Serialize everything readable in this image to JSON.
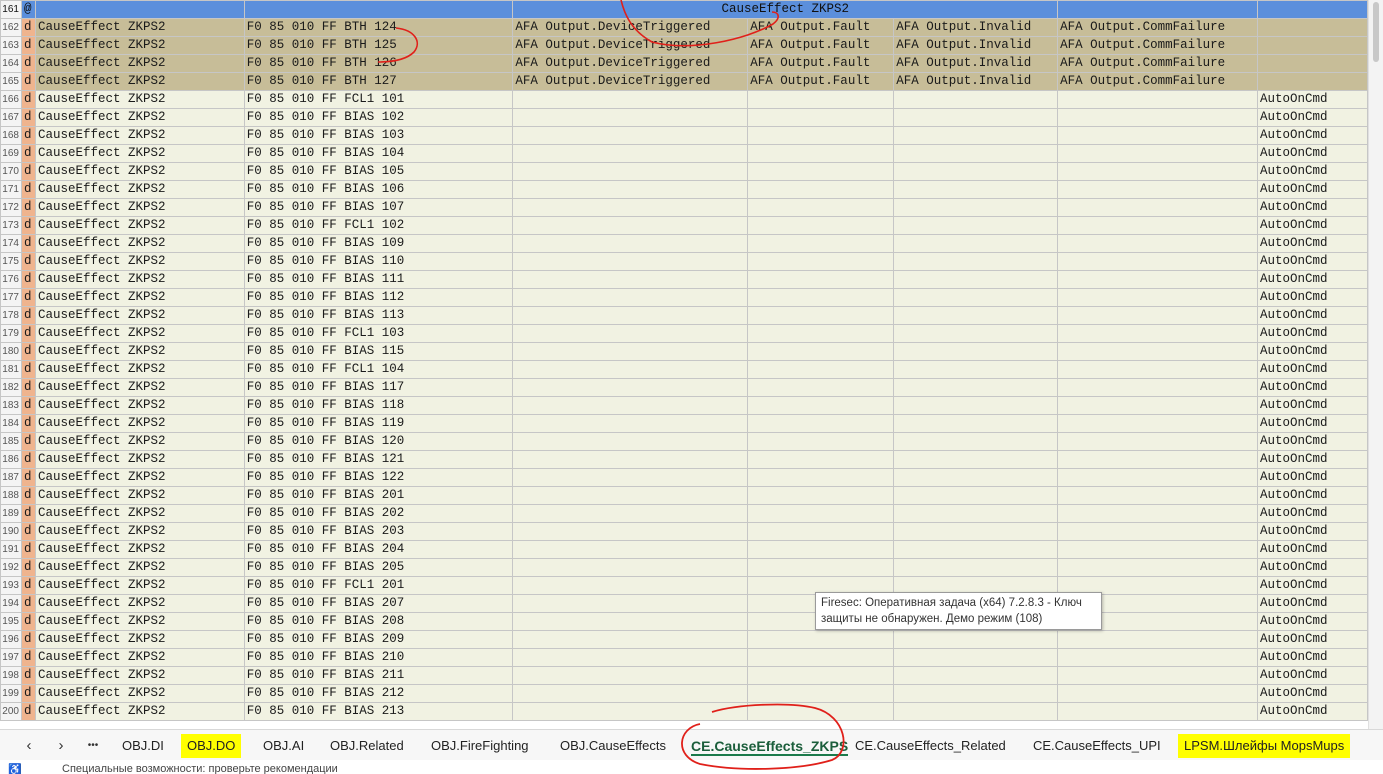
{
  "sheet": {
    "header": {
      "row_num": "161",
      "flag": "@",
      "title": "CauseEffect ZKPS2"
    },
    "rows": [
      {
        "num": "162",
        "flag": "d",
        "group": "CauseEffect ZKPS2",
        "device": "F0 85 010 FF BTH 124",
        "c3": "AFA Output.DeviceTriggered",
        "c4": "AFA Output.Fault",
        "c5": "AFA Output.Invalid",
        "c6": "AFA Output.CommFailure",
        "c7": "",
        "style": "dark"
      },
      {
        "num": "163",
        "flag": "d",
        "group": "CauseEffect ZKPS2",
        "device": "F0 85 010 FF BTH 125",
        "c3": "AFA Output.DeviceTriggered",
        "c4": "AFA Output.Fault",
        "c5": "AFA Output.Invalid",
        "c6": "AFA Output.CommFailure",
        "c7": "",
        "style": "dark"
      },
      {
        "num": "164",
        "flag": "d",
        "group": "CauseEffect ZKPS2",
        "device": "F0 85 010 FF BTH 126",
        "c3": "AFA Output.DeviceTriggered",
        "c4": "AFA Output.Fault",
        "c5": "AFA Output.Invalid",
        "c6": "AFA Output.CommFailure",
        "c7": "",
        "style": "dark"
      },
      {
        "num": "165",
        "flag": "d",
        "group": "CauseEffect ZKPS2",
        "device": "F0 85 010 FF BTH 127",
        "c3": "AFA Output.DeviceTriggered",
        "c4": "AFA Output.Fault",
        "c5": "AFA Output.Invalid",
        "c6": "AFA Output.CommFailure",
        "c7": "",
        "style": "dark"
      },
      {
        "num": "166",
        "flag": "d",
        "group": "CauseEffect ZKPS2",
        "device": "F0 85 010 FF FCL1 101",
        "c3": "",
        "c4": "",
        "c5": "",
        "c6": "",
        "c7": "AutoOnCmd",
        "style": "light"
      },
      {
        "num": "167",
        "flag": "d",
        "group": "CauseEffect ZKPS2",
        "device": "F0 85 010 FF BIAS 102",
        "c3": "",
        "c4": "",
        "c5": "",
        "c6": "",
        "c7": "AutoOnCmd",
        "style": "light"
      },
      {
        "num": "168",
        "flag": "d",
        "group": "CauseEffect ZKPS2",
        "device": "F0 85 010 FF BIAS 103",
        "c3": "",
        "c4": "",
        "c5": "",
        "c6": "",
        "c7": "AutoOnCmd",
        "style": "light"
      },
      {
        "num": "169",
        "flag": "d",
        "group": "CauseEffect ZKPS2",
        "device": "F0 85 010 FF BIAS 104",
        "c3": "",
        "c4": "",
        "c5": "",
        "c6": "",
        "c7": "AutoOnCmd",
        "style": "light"
      },
      {
        "num": "170",
        "flag": "d",
        "group": "CauseEffect ZKPS2",
        "device": "F0 85 010 FF BIAS 105",
        "c3": "",
        "c4": "",
        "c5": "",
        "c6": "",
        "c7": "AutoOnCmd",
        "style": "light"
      },
      {
        "num": "171",
        "flag": "d",
        "group": "CauseEffect ZKPS2",
        "device": "F0 85 010 FF BIAS 106",
        "c3": "",
        "c4": "",
        "c5": "",
        "c6": "",
        "c7": "AutoOnCmd",
        "style": "light"
      },
      {
        "num": "172",
        "flag": "d",
        "group": "CauseEffect ZKPS2",
        "device": "F0 85 010 FF BIAS 107",
        "c3": "",
        "c4": "",
        "c5": "",
        "c6": "",
        "c7": "AutoOnCmd",
        "style": "light"
      },
      {
        "num": "173",
        "flag": "d",
        "group": "CauseEffect ZKPS2",
        "device": "F0 85 010 FF FCL1 102",
        "c3": "",
        "c4": "",
        "c5": "",
        "c6": "",
        "c7": "AutoOnCmd",
        "style": "light"
      },
      {
        "num": "174",
        "flag": "d",
        "group": "CauseEffect ZKPS2",
        "device": "F0 85 010 FF BIAS 109",
        "c3": "",
        "c4": "",
        "c5": "",
        "c6": "",
        "c7": "AutoOnCmd",
        "style": "light"
      },
      {
        "num": "175",
        "flag": "d",
        "group": "CauseEffect ZKPS2",
        "device": "F0 85 010 FF BIAS 110",
        "c3": "",
        "c4": "",
        "c5": "",
        "c6": "",
        "c7": "AutoOnCmd",
        "style": "light"
      },
      {
        "num": "176",
        "flag": "d",
        "group": "CauseEffect ZKPS2",
        "device": "F0 85 010 FF BIAS 111",
        "c3": "",
        "c4": "",
        "c5": "",
        "c6": "",
        "c7": "AutoOnCmd",
        "style": "light"
      },
      {
        "num": "177",
        "flag": "d",
        "group": "CauseEffect ZKPS2",
        "device": "F0 85 010 FF BIAS 112",
        "c3": "",
        "c4": "",
        "c5": "",
        "c6": "",
        "c7": "AutoOnCmd",
        "style": "light"
      },
      {
        "num": "178",
        "flag": "d",
        "group": "CauseEffect ZKPS2",
        "device": "F0 85 010 FF BIAS 113",
        "c3": "",
        "c4": "",
        "c5": "",
        "c6": "",
        "c7": "AutoOnCmd",
        "style": "light"
      },
      {
        "num": "179",
        "flag": "d",
        "group": "CauseEffect ZKPS2",
        "device": "F0 85 010 FF FCL1 103",
        "c3": "",
        "c4": "",
        "c5": "",
        "c6": "",
        "c7": "AutoOnCmd",
        "style": "light"
      },
      {
        "num": "180",
        "flag": "d",
        "group": "CauseEffect ZKPS2",
        "device": "F0 85 010 FF BIAS 115",
        "c3": "",
        "c4": "",
        "c5": "",
        "c6": "",
        "c7": "AutoOnCmd",
        "style": "light"
      },
      {
        "num": "181",
        "flag": "d",
        "group": "CauseEffect ZKPS2",
        "device": "F0 85 010 FF FCL1 104",
        "c3": "",
        "c4": "",
        "c5": "",
        "c6": "",
        "c7": "AutoOnCmd",
        "style": "light"
      },
      {
        "num": "182",
        "flag": "d",
        "group": "CauseEffect ZKPS2",
        "device": "F0 85 010 FF BIAS 117",
        "c3": "",
        "c4": "",
        "c5": "",
        "c6": "",
        "c7": "AutoOnCmd",
        "style": "light"
      },
      {
        "num": "183",
        "flag": "d",
        "group": "CauseEffect ZKPS2",
        "device": "F0 85 010 FF BIAS 118",
        "c3": "",
        "c4": "",
        "c5": "",
        "c6": "",
        "c7": "AutoOnCmd",
        "style": "light"
      },
      {
        "num": "184",
        "flag": "d",
        "group": "CauseEffect ZKPS2",
        "device": "F0 85 010 FF BIAS 119",
        "c3": "",
        "c4": "",
        "c5": "",
        "c6": "",
        "c7": "AutoOnCmd",
        "style": "light"
      },
      {
        "num": "185",
        "flag": "d",
        "group": "CauseEffect ZKPS2",
        "device": "F0 85 010 FF BIAS 120",
        "c3": "",
        "c4": "",
        "c5": "",
        "c6": "",
        "c7": "AutoOnCmd",
        "style": "light"
      },
      {
        "num": "186",
        "flag": "d",
        "group": "CauseEffect ZKPS2",
        "device": "F0 85 010 FF BIAS 121",
        "c3": "",
        "c4": "",
        "c5": "",
        "c6": "",
        "c7": "AutoOnCmd",
        "style": "light"
      },
      {
        "num": "187",
        "flag": "d",
        "group": "CauseEffect ZKPS2",
        "device": "F0 85 010 FF BIAS 122",
        "c3": "",
        "c4": "",
        "c5": "",
        "c6": "",
        "c7": "AutoOnCmd",
        "style": "light"
      },
      {
        "num": "188",
        "flag": "d",
        "group": "CauseEffect ZKPS2",
        "device": "F0 85 010 FF BIAS 201",
        "c3": "",
        "c4": "",
        "c5": "",
        "c6": "",
        "c7": "AutoOnCmd",
        "style": "light"
      },
      {
        "num": "189",
        "flag": "d",
        "group": "CauseEffect ZKPS2",
        "device": "F0 85 010 FF BIAS 202",
        "c3": "",
        "c4": "",
        "c5": "",
        "c6": "",
        "c7": "AutoOnCmd",
        "style": "light"
      },
      {
        "num": "190",
        "flag": "d",
        "group": "CauseEffect ZKPS2",
        "device": "F0 85 010 FF BIAS 203",
        "c3": "",
        "c4": "",
        "c5": "",
        "c6": "",
        "c7": "AutoOnCmd",
        "style": "light"
      },
      {
        "num": "191",
        "flag": "d",
        "group": "CauseEffect ZKPS2",
        "device": "F0 85 010 FF BIAS 204",
        "c3": "",
        "c4": "",
        "c5": "",
        "c6": "",
        "c7": "AutoOnCmd",
        "style": "light"
      },
      {
        "num": "192",
        "flag": "d",
        "group": "CauseEffect ZKPS2",
        "device": "F0 85 010 FF BIAS 205",
        "c3": "",
        "c4": "",
        "c5": "",
        "c6": "",
        "c7": "AutoOnCmd",
        "style": "light"
      },
      {
        "num": "193",
        "flag": "d",
        "group": "CauseEffect ZKPS2",
        "device": "F0 85 010 FF FCL1 201",
        "c3": "",
        "c4": "",
        "c5": "",
        "c6": "",
        "c7": "AutoOnCmd",
        "style": "light"
      },
      {
        "num": "194",
        "flag": "d",
        "group": "CauseEffect ZKPS2",
        "device": "F0 85 010 FF BIAS 207",
        "c3": "",
        "c4": "",
        "c5": "",
        "c6": "",
        "c7": "AutoOnCmd",
        "style": "light"
      },
      {
        "num": "195",
        "flag": "d",
        "group": "CauseEffect ZKPS2",
        "device": "F0 85 010 FF BIAS 208",
        "c3": "",
        "c4": "",
        "c5": "",
        "c6": "",
        "c7": "AutoOnCmd",
        "style": "light"
      },
      {
        "num": "196",
        "flag": "d",
        "group": "CauseEffect ZKPS2",
        "device": "F0 85 010 FF BIAS 209",
        "c3": "",
        "c4": "",
        "c5": "",
        "c6": "",
        "c7": "AutoOnCmd",
        "style": "light"
      },
      {
        "num": "197",
        "flag": "d",
        "group": "CauseEffect ZKPS2",
        "device": "F0 85 010 FF BIAS 210",
        "c3": "",
        "c4": "",
        "c5": "",
        "c6": "",
        "c7": "AutoOnCmd",
        "style": "light"
      },
      {
        "num": "198",
        "flag": "d",
        "group": "CauseEffect ZKPS2",
        "device": "F0 85 010 FF BIAS 211",
        "c3": "",
        "c4": "",
        "c5": "",
        "c6": "",
        "c7": "AutoOnCmd",
        "style": "light"
      },
      {
        "num": "199",
        "flag": "d",
        "group": "CauseEffect ZKPS2",
        "device": "F0 85 010 FF BIAS 212",
        "c3": "",
        "c4": "",
        "c5": "",
        "c6": "",
        "c7": "AutoOnCmd",
        "style": "light"
      },
      {
        "num": "200",
        "flag": "d",
        "group": "CauseEffect ZKPS2",
        "device": "F0 85 010 FF BIAS 213",
        "c3": "",
        "c4": "",
        "c5": "",
        "c6": "",
        "c7": "AutoOnCmd",
        "style": "light"
      }
    ]
  },
  "tabs": {
    "nav": {
      "prev": "‹",
      "next": "›",
      "more": "•••"
    },
    "items": [
      {
        "label": "OBJ.DI",
        "highlight": false,
        "active": false
      },
      {
        "label": "OBJ.DO",
        "highlight": true,
        "active": false
      },
      {
        "label": "OBJ.AI",
        "highlight": false,
        "active": false
      },
      {
        "label": "OBJ.Related",
        "highlight": false,
        "active": false
      },
      {
        "label": "OBJ.FireFighting",
        "highlight": false,
        "active": false
      },
      {
        "label": "OBJ.CauseEffects",
        "highlight": false,
        "active": false
      },
      {
        "label": "CE.CauseEffects_ZKPS",
        "highlight": false,
        "active": true
      },
      {
        "label": "CE.CauseEffects_Related",
        "highlight": false,
        "active": false
      },
      {
        "label": "CE.CauseEffects_UPI",
        "highlight": false,
        "active": false
      },
      {
        "label": "LPSM.Шлейфы MopsMups",
        "highlight": true,
        "active": false
      }
    ]
  },
  "tooltip": {
    "line1": "Firesec: Оперативная задача  (x64) 7.2.8.3 - Ключ",
    "line2": "защиты не обнаружен. Демо режим (108)"
  },
  "status": {
    "icon": "accessibility-icon",
    "text": "Специальные возможности: проверьте рекомендации"
  },
  "colors": {
    "header_row": "#5b8fdc",
    "dark_row": "#c7bd98",
    "light_row": "#f1f2e2",
    "flag_cell": "#efb48e",
    "highlight_tab": "#ffff00",
    "ink_annotation": "#e0201a"
  }
}
